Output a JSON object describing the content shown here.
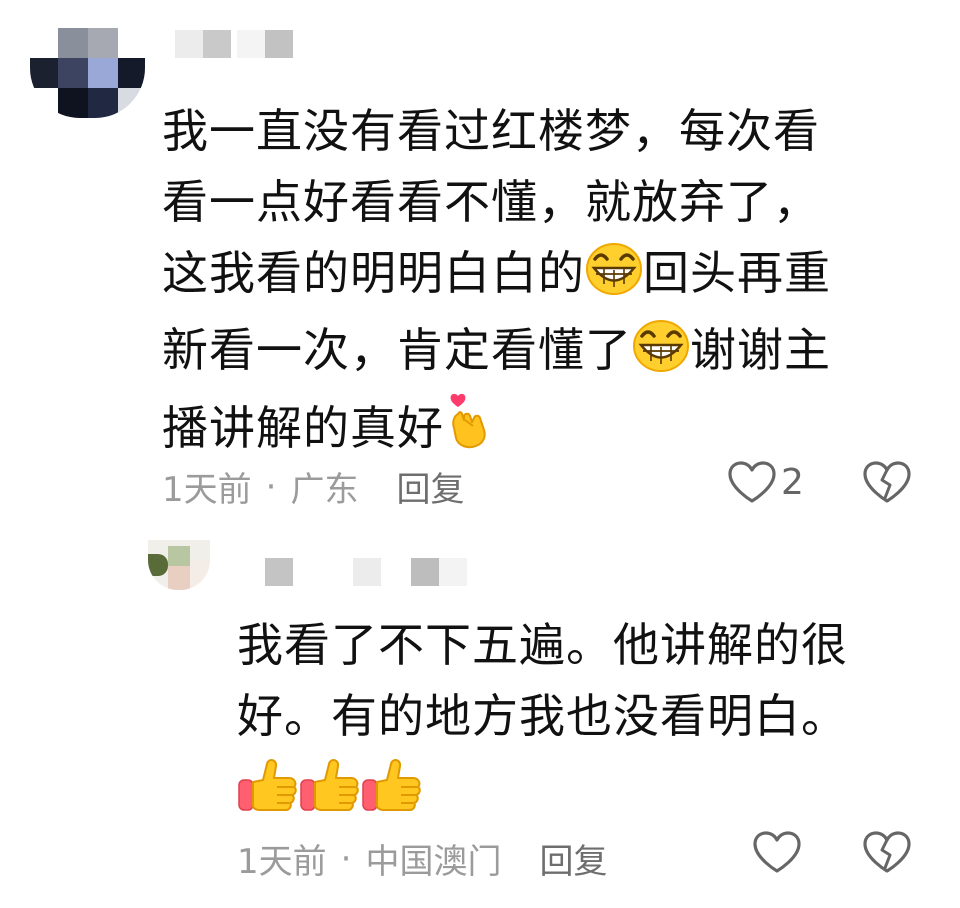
{
  "comments": [
    {
      "text_lines": [
        "我一直没有看过红楼梦，每次看",
        "看一点好看看不懂，就放弃了，",
        [
          "这我看的明明白白的",
          "grin-emoji",
          "回头再重"
        ],
        [
          "新看一次，肯定看懂了",
          "grin-emoji",
          "谢谢主"
        ],
        [
          "播讲解的真好",
          "finger-heart-emoji",
          ""
        ]
      ],
      "time": "1天前",
      "separator": "·",
      "location": "广东",
      "reply_label": "回复",
      "like_count": "2",
      "icons": {
        "like": "heart-outline-icon",
        "dislike": "broken-heart-icon"
      }
    },
    {
      "text_lines": [
        "我看了不下五遍。他讲解的很",
        "好。有的地方我也没看明白。"
      ],
      "emoji_row": [
        "thumbs-up-emoji",
        "thumbs-up-emoji",
        "thumbs-up-emoji"
      ],
      "time": "1天前",
      "separator": "·",
      "location": "中国澳门",
      "reply_label": "回复",
      "icons": {
        "like": "heart-outline-icon",
        "dislike": "broken-heart-icon"
      }
    }
  ],
  "colors": {
    "text": "#111111",
    "meta": "#9b9b9b",
    "reply": "#6e6e6e",
    "icon": "#666666"
  }
}
